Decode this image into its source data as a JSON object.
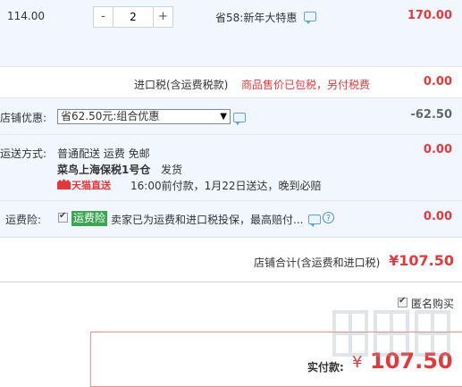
{
  "item_row": {
    "unit_price": "114.00",
    "quantity": "2",
    "minus": "-",
    "plus": "+",
    "discount_text": "省58:新年大特惠",
    "subtotal": "170.00"
  },
  "import_tax": {
    "label": "进口税(含运费税款)",
    "notice": "商品售价已包税，另付税费",
    "amount": "0.00"
  },
  "shop_discount": {
    "label": "店铺优惠:",
    "selected": "省62.50元:组合优惠",
    "amount": "-62.50"
  },
  "shipping": {
    "label": "运送方式:",
    "method": "普通配送 运费 免邮",
    "warehouse": "菜鸟上海保税1号仓",
    "dispatch": "发货",
    "service_badge": "天猫直送",
    "delivery_note": "16:00前付款，1月22日送达，晚到必赔",
    "amount": "0.00"
  },
  "insurance": {
    "label": "运费险:",
    "checked": true,
    "tag": "运费险",
    "text": "卖家已为运费和进口税投保，最高赔付...",
    "amount": "0.00"
  },
  "shop_total": {
    "label": "店铺合计(含运费和进口税)",
    "value": "¥107.50"
  },
  "anonymous": {
    "checked": true,
    "label": "匿名购买"
  },
  "payment": {
    "label": "实付款:",
    "currency": "¥",
    "value": "107.50"
  },
  "colors": {
    "accent_red": "#e4393c",
    "panel_bg": "#f2f7ff",
    "tag_green": "#3aa651",
    "link_blue": "#4a90d9"
  },
  "icons": [
    "message-icon",
    "chevron-down-icon",
    "tmall-icon",
    "question-icon",
    "checkbox-icon"
  ]
}
